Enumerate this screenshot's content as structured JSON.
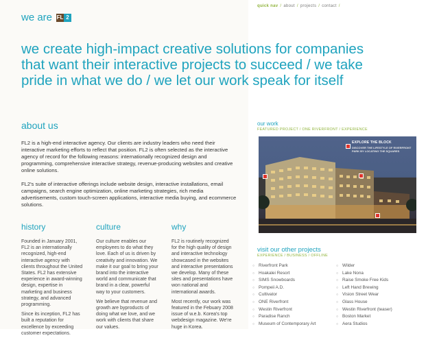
{
  "logo": {
    "text": "we are",
    "box1": "FL",
    "box2": "2"
  },
  "nav": {
    "quick": "quick nav",
    "items": [
      "about",
      "projects",
      "contact"
    ]
  },
  "hero": "we create high-impact creative solutions for companies that want their interactive projects to succeed / we take pride in what we do / we let our work speak for itself",
  "about": {
    "title": "about us",
    "p1": "FL2 is a high-end interactive agency. Our clients are industry leaders who need their interactive marketing efforts to reflect that position. FL2 is often selected as the interactive agency of record for the following reasons: internationally recognized design and programming, comprehensive interactive strategy, revenue-producing websites and creative online solutions.",
    "p2": "FL2's suite of interactive offerings include website design, interactive installations, email campaigns, search engine optimization, online marketing strategies, rich media advertisements, custom touch-screen applications, interactive media buying, and ecommerce solutions."
  },
  "history": {
    "title": "history",
    "p1": "Founded in January 2001, FL2 is an internationally recognized, high-end interactive agency with clients throughout the United States. FL2 has extensive experience in award-winning design, expertise in marketing and business strategy, and advanced programming.",
    "p2": "Since its inception, FL2 has built a reputation for excellence by exceeding customer expectations."
  },
  "culture": {
    "title": "culture",
    "p1": "Our culture enables our employees to do what they love. Each of us is driven by creativity and innovation. We make it our goal to bring your brand into the interactive world and communicate that brand in a clear, powerful way to your customers.",
    "p2": "We believe that revenue and growth are byproducts of doing what we love, and we work with clients that share our values."
  },
  "why": {
    "title": "why",
    "p1": "FL2 is routinely recognized for the high quality of design and interactive technology showcased in the websites and interactive presentations we develop. Many of these sites and presentations have won national and international awards.",
    "p2": "Most recently, our work was featured in the Febuary 2008 issue of w.e.b. Korea's top webdesign magazine. We're huge in Korea."
  },
  "our_work": {
    "title": "our work",
    "sub": "FEATURED PROJECT / ONE RIVERFRONT / EXPERIENCE",
    "explore": "EXPLORE THE BLOCK",
    "explore_sub": "DISCOVER THE LIFESTYLE OF RIVERFRONT PARK BY LOCATING THE SQUARES",
    "colors": {
      "sky": "#4f6289",
      "building": "#c9b78e",
      "accent": "#e0342c"
    }
  },
  "visit": {
    "title": "visit our other projects",
    "sub": "EXPERIENCE / BUSINESS / OFFLINE",
    "list1": [
      "Riverfront Park",
      "Hoakalei Resort",
      "SIMS Snowboards",
      "Pompeii A.D.",
      "Cultivator",
      "ONE Riverfront",
      "Westin Riverfront",
      "Paradise Ranch",
      "Museum of Contemporary Art"
    ],
    "list2": [
      "Wilder",
      "Lake Nona",
      "Raise Smoke Free Kids",
      "Left Hand Brewing",
      "Vision Street Wear",
      "Glass House",
      "Westin Riverfront (teaser)",
      "Boston Market",
      "Aera Studios"
    ]
  },
  "colors": {
    "accent": "#1fa3be",
    "green": "#8fb33a",
    "text": "#333333",
    "panel": "#fbfaf7"
  }
}
